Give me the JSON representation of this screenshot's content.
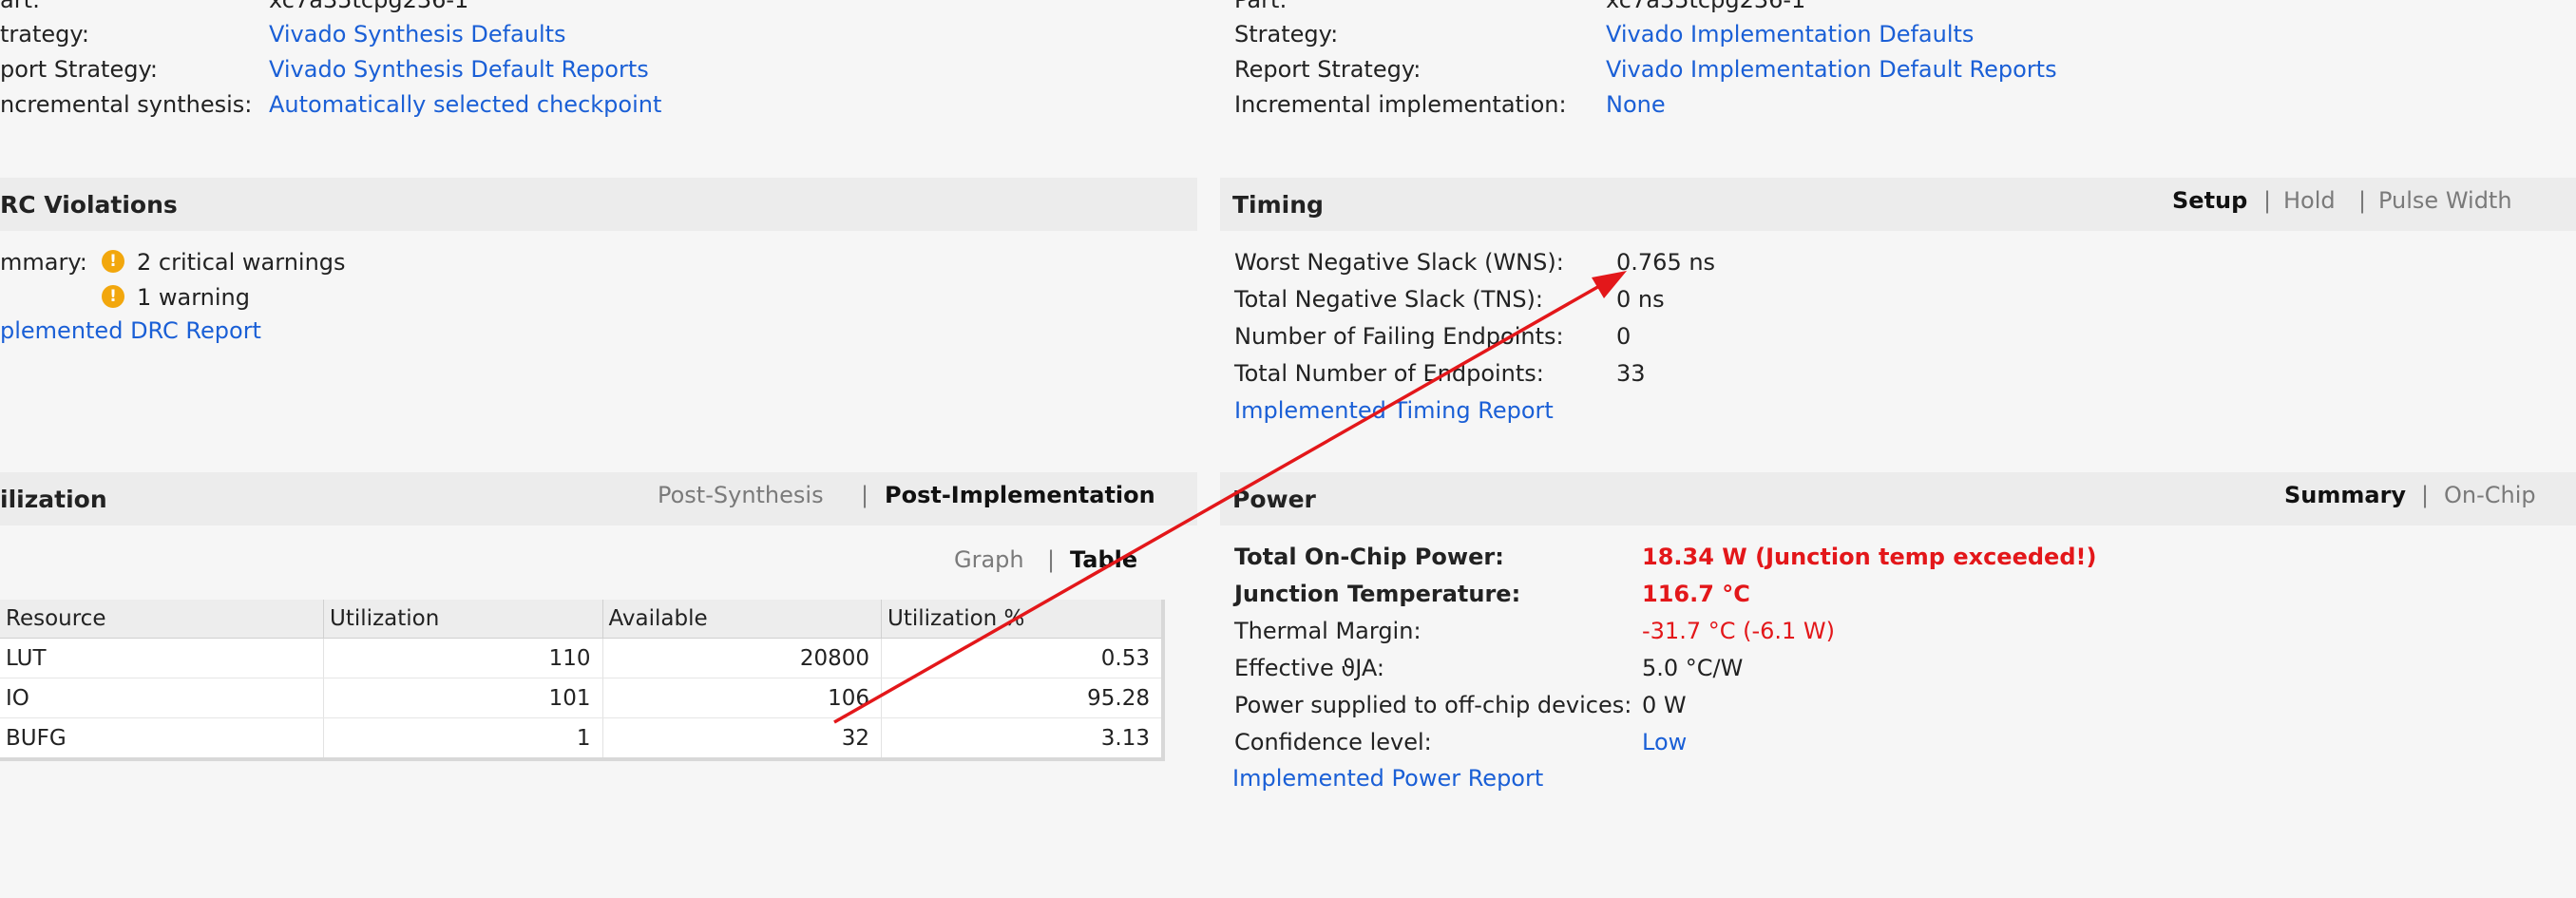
{
  "synthesis": {
    "rows": [
      {
        "label": "art:",
        "value": "xc7a35tcpg236-1"
      },
      {
        "label": "trategy:",
        "value": "Vivado Synthesis Defaults"
      },
      {
        "label": "port Strategy:",
        "value": "Vivado Synthesis Default Reports"
      },
      {
        "label": "ncremental synthesis:",
        "value": "Automatically selected checkpoint"
      }
    ]
  },
  "implementation": {
    "rows": [
      {
        "label": "Part:",
        "value": "xc7a35tcpg236-1"
      },
      {
        "label": "Strategy:",
        "value": "Vivado Implementation Defaults"
      },
      {
        "label": "Report Strategy:",
        "value": "Vivado Implementation Default Reports"
      },
      {
        "label": "Incremental implementation:",
        "value": "None"
      }
    ]
  },
  "drc": {
    "title": "RC Violations",
    "summary_label": "mmary:",
    "critical_warnings": "2 critical warnings",
    "warnings": "1 warning",
    "report_link": "plemented DRC Report"
  },
  "timing": {
    "title": "Timing",
    "tabs": [
      "Setup",
      "Hold",
      "Pulse Width"
    ],
    "active_tab": "Setup",
    "rows": [
      {
        "label": "Worst Negative Slack (WNS):",
        "value": "0.765 ns"
      },
      {
        "label": "Total Negative Slack (TNS):",
        "value": "0 ns"
      },
      {
        "label": "Number of Failing Endpoints:",
        "value": "0"
      },
      {
        "label": "Total Number of Endpoints:",
        "value": "33"
      }
    ],
    "report_link": "Implemented Timing Report"
  },
  "utilization": {
    "title": "ilization",
    "tabs": [
      "Post-Synthesis",
      "Post-Implementation"
    ],
    "active_tab": "Post-Implementation",
    "view_tabs": [
      "Graph",
      "Table"
    ],
    "active_view": "Table",
    "columns": [
      "Resource",
      "Utilization",
      "Available",
      "Utilization %"
    ],
    "rows": [
      [
        "LUT",
        "110",
        "20800",
        "0.53"
      ],
      [
        "IO",
        "101",
        "106",
        "95.28"
      ],
      [
        "BUFG",
        "1",
        "32",
        "3.13"
      ]
    ]
  },
  "power": {
    "title": "Power",
    "tabs": [
      "Summary",
      "On-Chip"
    ],
    "active_tab": "Summary",
    "rows": [
      {
        "label": "Total On-Chip Power:",
        "value": "18.34 W (Junction temp exceeded!)"
      },
      {
        "label": "Junction Temperature:",
        "value": "116.7 °C"
      },
      {
        "label": "Thermal Margin:",
        "value": "-31.7 °C (-6.1 W)"
      },
      {
        "label": "Effective ϑJA:",
        "value": "5.0 °C/W"
      },
      {
        "label": "Power supplied to off-chip devices:",
        "value": "0 W"
      },
      {
        "label": "Confidence level:",
        "value": "Low"
      }
    ],
    "report_link": "Implemented Power Report"
  },
  "colors": {
    "link": "#1a5fd6",
    "error": "#e3171a",
    "warning_icon": "#f2a70d",
    "annotation_arrow": "#e3171a"
  }
}
